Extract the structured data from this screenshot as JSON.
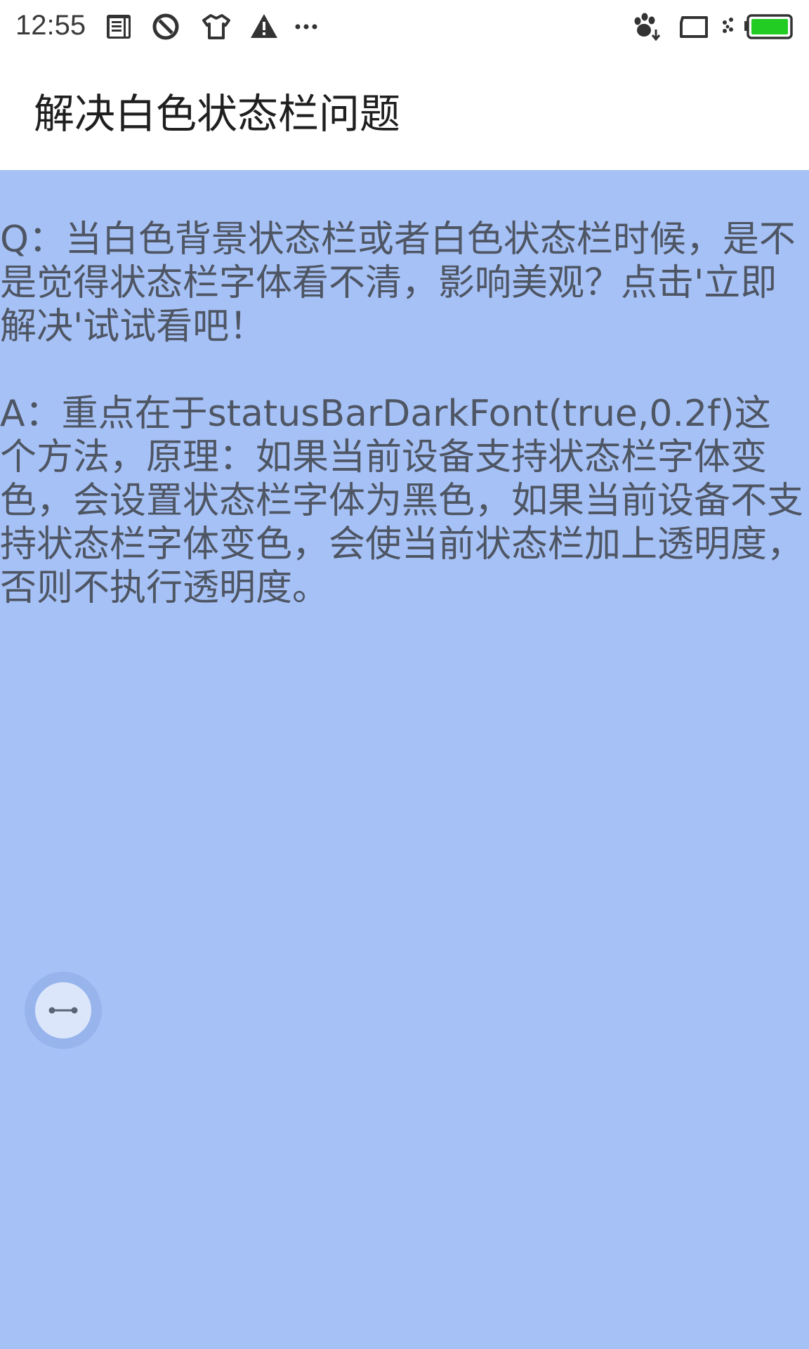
{
  "status_bar": {
    "time": "12:55",
    "icons_left": [
      "notes-icon",
      "blocked-icon",
      "tshirt-icon",
      "warning-icon",
      "more-icon"
    ],
    "icons_right": [
      "paw-download-icon",
      "screen-cast-icon",
      "signal-icon",
      "battery-icon"
    ],
    "battery_color": "#22cc22"
  },
  "title_bar": {
    "title": "解决白色状态栏问题"
  },
  "content": {
    "question": "Q：当白色背景状态栏或者白色状态栏时候，是不是觉得状态栏字体看不清，影响美观？点击'立即解决'试试看吧！",
    "answer": "A：重点在于statusBarDarkFont(true,0.2f)这个方法，原理：如果当前设备支持状态栏字体变色，会设置状态栏字体为黑色，如果当前设备不支持状态栏字体变色，会使当前状态栏加上透明度，否则不执行透明度。",
    "background_color": "#a6c1f5"
  },
  "assist_button": {
    "icon": "drag-handle-icon"
  }
}
